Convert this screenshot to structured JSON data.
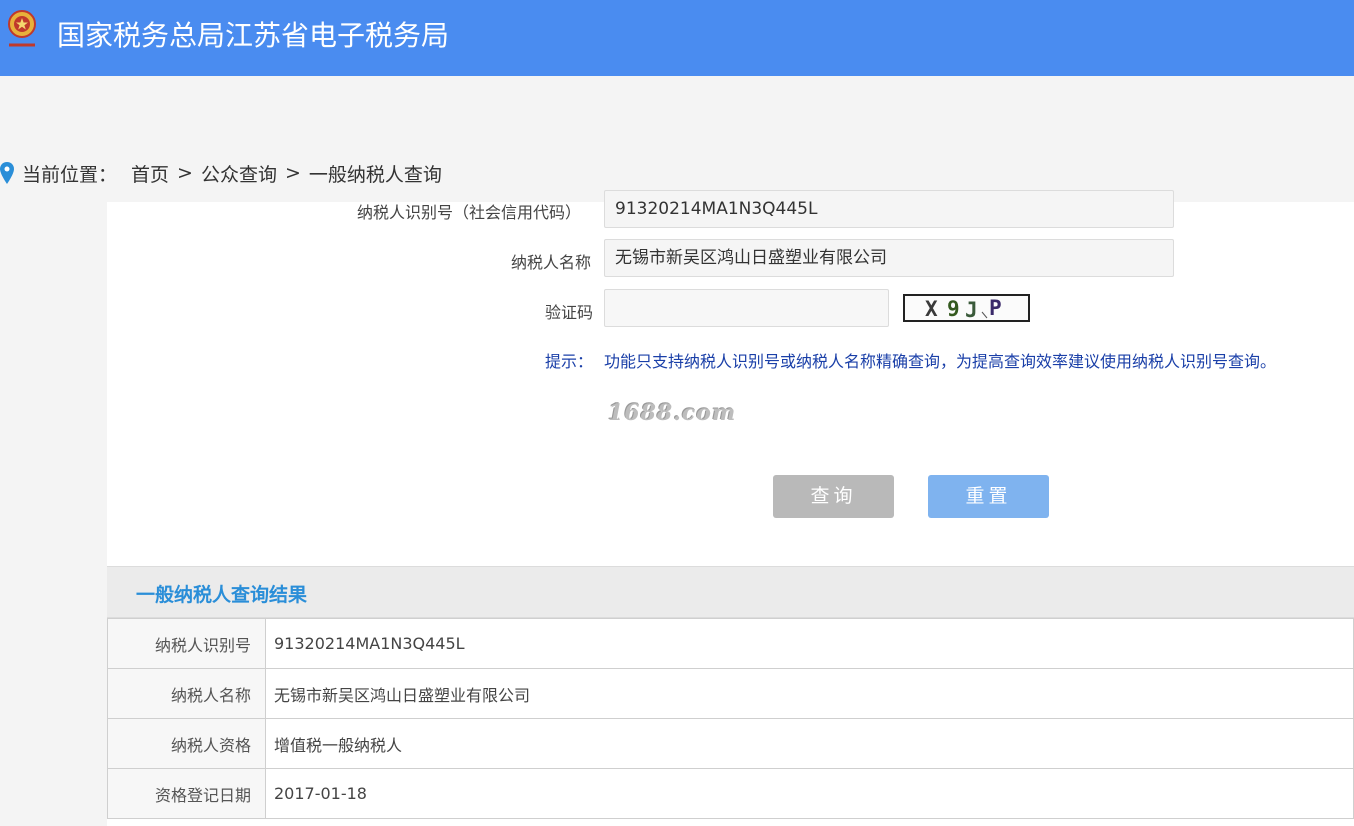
{
  "header": {
    "title": "国家税务总局江苏省电子税务局"
  },
  "breadcrumb": {
    "prefix": "当前位置：",
    "items": [
      "首页",
      "公众查询",
      "一般纳税人查询"
    ],
    "separator": ">"
  },
  "form": {
    "id_label": "纳税人识别号（社会信用代码）",
    "id_value": "91320214MA1N3Q445L",
    "name_label": "纳税人名称",
    "name_value": "无锡市新吴区鸿山日盛塑业有限公司",
    "captcha_label": "验证码",
    "captcha_value": "",
    "captcha_text": "X9JP",
    "tip_label": "提示：",
    "tip_text": "功能只支持纳税人识别号或纳税人名称精确查询，为提高查询效率建议使用纳税人识别号查询。",
    "watermark": "1688.com",
    "query_button": "查询",
    "reset_button": "重置"
  },
  "result": {
    "title": "一般纳税人查询结果",
    "rows": [
      {
        "label": "纳税人识别号",
        "value": "91320214MA1N3Q445L"
      },
      {
        "label": "纳税人名称",
        "value": "无锡市新吴区鸿山日盛塑业有限公司"
      },
      {
        "label": "纳税人资格",
        "value": "增值税一般纳税人"
      },
      {
        "label": "资格登记日期",
        "value": "2017-01-18"
      }
    ]
  },
  "colors": {
    "header_bg": "#4a8cf0",
    "tip_text": "#1a3fa8",
    "result_title": "#2a8ed8",
    "query_button_bg": "#b9b9b9",
    "reset_button_bg": "#7fb3ef"
  }
}
